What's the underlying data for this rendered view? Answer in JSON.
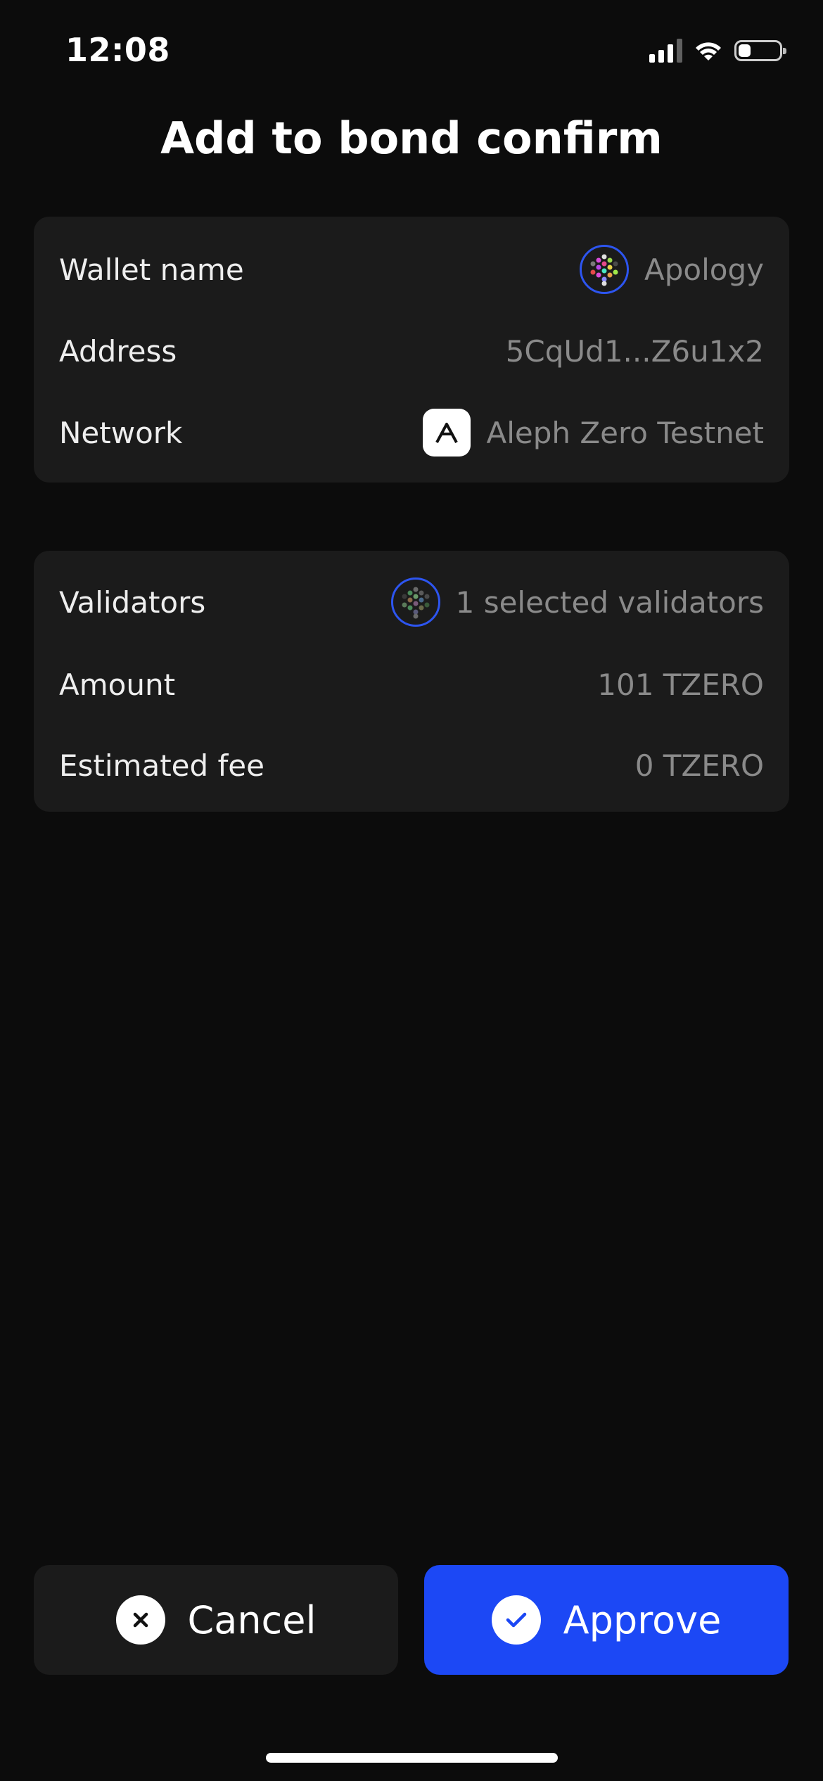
{
  "status": {
    "time": "12:08",
    "battery_level": 0.3
  },
  "page": {
    "title": "Add to bond confirm"
  },
  "account": {
    "wallet_label": "Wallet name",
    "wallet_value": "Apology",
    "address_label": "Address",
    "address_value": "5CqUd1...Z6u1x2",
    "network_label": "Network",
    "network_value": "Aleph Zero Testnet"
  },
  "bond": {
    "validators_label": "Validators",
    "validators_value": "1 selected validators",
    "amount_label": "Amount",
    "amount_value": "101 TZERO",
    "fee_label": "Estimated fee",
    "fee_value": "0 TZERO"
  },
  "actions": {
    "cancel_label": "Cancel",
    "approve_label": "Approve"
  },
  "colors": {
    "accent": "#1c48f5",
    "card": "#1b1b1b",
    "background": "#0c0c0c",
    "muted_text": "#8a8a8a"
  },
  "icons": {
    "signal": "cellular-signal-icon",
    "wifi": "wifi-icon",
    "battery": "battery-icon",
    "wallet": "wallet-identicon",
    "network": "aleph-zero-logo",
    "validator": "validator-identicon",
    "cancel": "close-icon",
    "approve": "check-icon"
  }
}
